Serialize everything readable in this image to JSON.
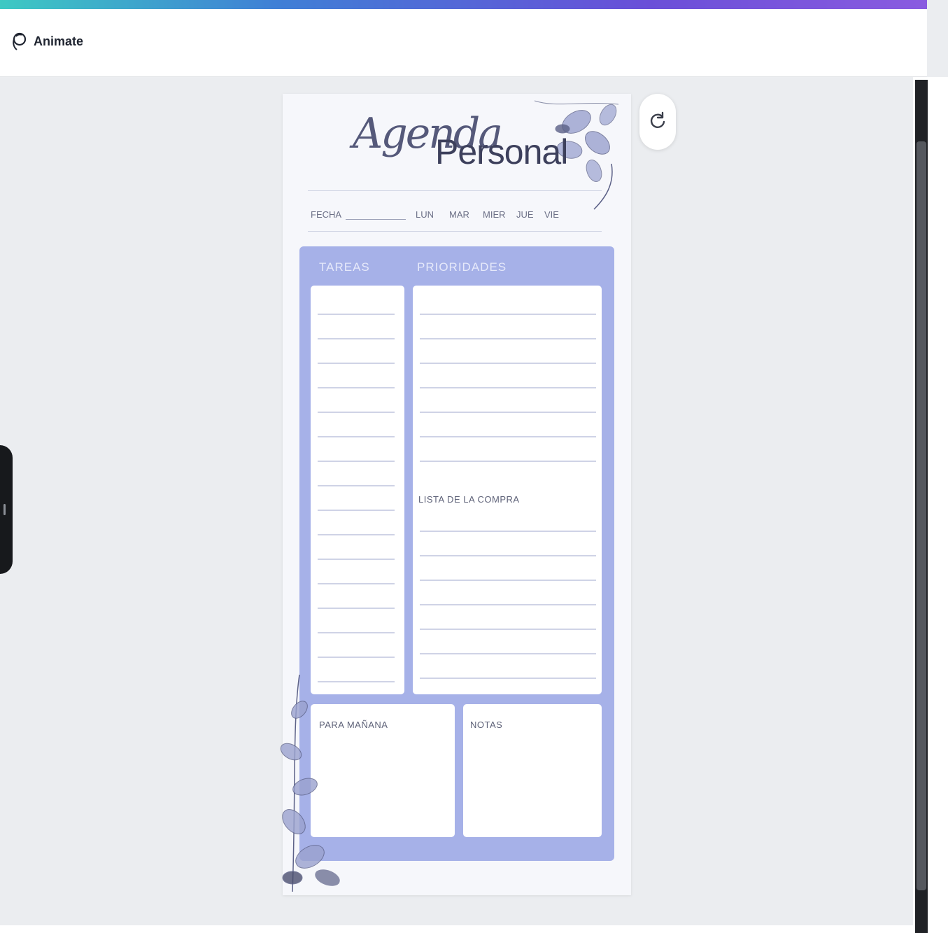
{
  "toolbar": {
    "animate_label": "Animate",
    "animate_icon": "animate-icon"
  },
  "page": {
    "title_script": "Agenda",
    "title_main": "Personal",
    "date_label": "FECHA",
    "days": [
      "LUN",
      "MAR",
      "MIER",
      "JUE",
      "VIE"
    ],
    "columns": {
      "tasks": "TAREAS",
      "priorities": "PRIORIDADES"
    },
    "shopping_list_label": "LISTA DE LA COMPRA",
    "tomorrow_label": "PARA MAÑANA",
    "notes_label": "NOTAS"
  },
  "colors": {
    "panel": "#a6b1e8",
    "accent_gradient": [
      "#3ec9c3",
      "#3f7fd6",
      "#8a5be0"
    ]
  },
  "icons": {
    "refresh": "refresh-icon"
  }
}
